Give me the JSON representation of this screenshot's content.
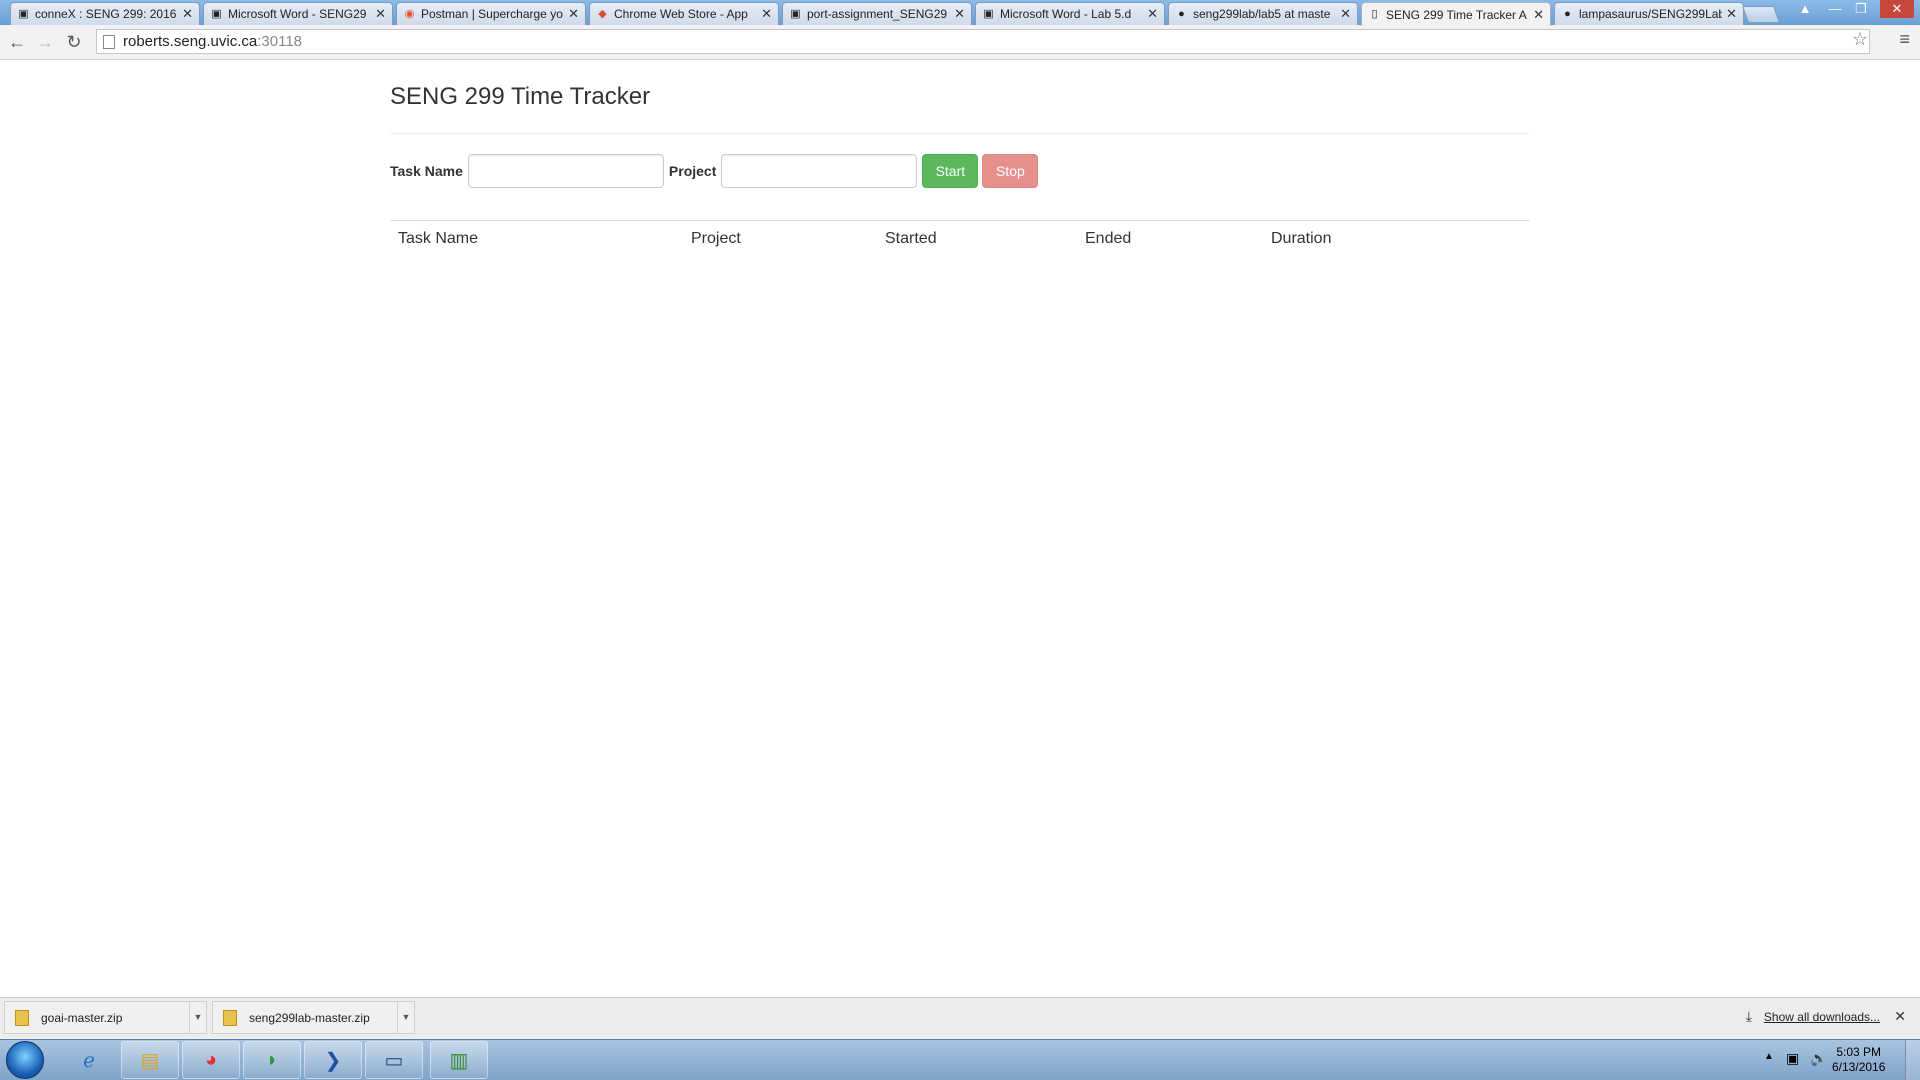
{
  "tabs": [
    {
      "title": "conneX : SENG 299: 2016",
      "icon": "connex-icon"
    },
    {
      "title": "Microsoft Word - SENG29",
      "icon": "document-icon"
    },
    {
      "title": "Postman | Supercharge yo",
      "icon": "postman-icon"
    },
    {
      "title": "Chrome Web Store - App",
      "icon": "webstore-icon"
    },
    {
      "title": "port-assignment_SENG29",
      "icon": "document-icon"
    },
    {
      "title": "Microsoft Word - Lab 5.d",
      "icon": "document-icon"
    },
    {
      "title": "seng299lab/lab5 at maste",
      "icon": "github-icon"
    },
    {
      "title": "SENG 299 Time Tracker A",
      "icon": "page-icon",
      "active": true
    },
    {
      "title": "lampasaurus/SENG299Lab",
      "icon": "github-icon"
    }
  ],
  "address": {
    "host": "roberts.seng.uvic.ca",
    "port": ":30118"
  },
  "page": {
    "title": "SENG 299 Time Tracker",
    "form": {
      "task_label": "Task Name",
      "task_value": "",
      "project_label": "Project",
      "project_value": "",
      "start_label": "Start",
      "stop_label": "Stop"
    },
    "table": {
      "headers": [
        "Task Name",
        "Project",
        "Started",
        "Ended",
        "Duration"
      ],
      "rows": []
    }
  },
  "downloads": {
    "items": [
      {
        "name": "goai-master.zip"
      },
      {
        "name": "seng299lab-master.zip"
      }
    ],
    "show_all": "Show all downloads..."
  },
  "taskbar": {
    "apps": [
      "internet-explorer-icon",
      "file-explorer-icon",
      "chrome-icon",
      "sourcetree-icon",
      "powershell-icon",
      "remote-desktop-icon",
      "task-manager-icon"
    ],
    "time": "5:03 PM",
    "date": "6/13/2016"
  },
  "colors": {
    "start": "#5cb85c",
    "stop": "#e6908e",
    "taskbar": "#7fa3c9"
  }
}
